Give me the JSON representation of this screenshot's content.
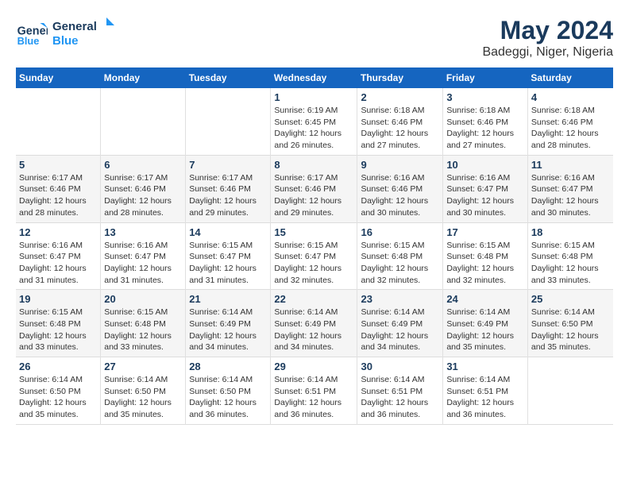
{
  "header": {
    "logo_line1": "General",
    "logo_line2": "Blue",
    "month": "May 2024",
    "location": "Badeggi, Niger, Nigeria"
  },
  "days_of_week": [
    "Sunday",
    "Monday",
    "Tuesday",
    "Wednesday",
    "Thursday",
    "Friday",
    "Saturday"
  ],
  "weeks": [
    [
      {
        "day": "",
        "info": ""
      },
      {
        "day": "",
        "info": ""
      },
      {
        "day": "",
        "info": ""
      },
      {
        "day": "1",
        "info": "Sunrise: 6:19 AM\nSunset: 6:45 PM\nDaylight: 12 hours\nand 26 minutes."
      },
      {
        "day": "2",
        "info": "Sunrise: 6:18 AM\nSunset: 6:46 PM\nDaylight: 12 hours\nand 27 minutes."
      },
      {
        "day": "3",
        "info": "Sunrise: 6:18 AM\nSunset: 6:46 PM\nDaylight: 12 hours\nand 27 minutes."
      },
      {
        "day": "4",
        "info": "Sunrise: 6:18 AM\nSunset: 6:46 PM\nDaylight: 12 hours\nand 28 minutes."
      }
    ],
    [
      {
        "day": "5",
        "info": "Sunrise: 6:17 AM\nSunset: 6:46 PM\nDaylight: 12 hours\nand 28 minutes."
      },
      {
        "day": "6",
        "info": "Sunrise: 6:17 AM\nSunset: 6:46 PM\nDaylight: 12 hours\nand 28 minutes."
      },
      {
        "day": "7",
        "info": "Sunrise: 6:17 AM\nSunset: 6:46 PM\nDaylight: 12 hours\nand 29 minutes."
      },
      {
        "day": "8",
        "info": "Sunrise: 6:17 AM\nSunset: 6:46 PM\nDaylight: 12 hours\nand 29 minutes."
      },
      {
        "day": "9",
        "info": "Sunrise: 6:16 AM\nSunset: 6:46 PM\nDaylight: 12 hours\nand 30 minutes."
      },
      {
        "day": "10",
        "info": "Sunrise: 6:16 AM\nSunset: 6:47 PM\nDaylight: 12 hours\nand 30 minutes."
      },
      {
        "day": "11",
        "info": "Sunrise: 6:16 AM\nSunset: 6:47 PM\nDaylight: 12 hours\nand 30 minutes."
      }
    ],
    [
      {
        "day": "12",
        "info": "Sunrise: 6:16 AM\nSunset: 6:47 PM\nDaylight: 12 hours\nand 31 minutes."
      },
      {
        "day": "13",
        "info": "Sunrise: 6:16 AM\nSunset: 6:47 PM\nDaylight: 12 hours\nand 31 minutes."
      },
      {
        "day": "14",
        "info": "Sunrise: 6:15 AM\nSunset: 6:47 PM\nDaylight: 12 hours\nand 31 minutes."
      },
      {
        "day": "15",
        "info": "Sunrise: 6:15 AM\nSunset: 6:47 PM\nDaylight: 12 hours\nand 32 minutes."
      },
      {
        "day": "16",
        "info": "Sunrise: 6:15 AM\nSunset: 6:48 PM\nDaylight: 12 hours\nand 32 minutes."
      },
      {
        "day": "17",
        "info": "Sunrise: 6:15 AM\nSunset: 6:48 PM\nDaylight: 12 hours\nand 32 minutes."
      },
      {
        "day": "18",
        "info": "Sunrise: 6:15 AM\nSunset: 6:48 PM\nDaylight: 12 hours\nand 33 minutes."
      }
    ],
    [
      {
        "day": "19",
        "info": "Sunrise: 6:15 AM\nSunset: 6:48 PM\nDaylight: 12 hours\nand 33 minutes."
      },
      {
        "day": "20",
        "info": "Sunrise: 6:15 AM\nSunset: 6:48 PM\nDaylight: 12 hours\nand 33 minutes."
      },
      {
        "day": "21",
        "info": "Sunrise: 6:14 AM\nSunset: 6:49 PM\nDaylight: 12 hours\nand 34 minutes."
      },
      {
        "day": "22",
        "info": "Sunrise: 6:14 AM\nSunset: 6:49 PM\nDaylight: 12 hours\nand 34 minutes."
      },
      {
        "day": "23",
        "info": "Sunrise: 6:14 AM\nSunset: 6:49 PM\nDaylight: 12 hours\nand 34 minutes."
      },
      {
        "day": "24",
        "info": "Sunrise: 6:14 AM\nSunset: 6:49 PM\nDaylight: 12 hours\nand 35 minutes."
      },
      {
        "day": "25",
        "info": "Sunrise: 6:14 AM\nSunset: 6:50 PM\nDaylight: 12 hours\nand 35 minutes."
      }
    ],
    [
      {
        "day": "26",
        "info": "Sunrise: 6:14 AM\nSunset: 6:50 PM\nDaylight: 12 hours\nand 35 minutes."
      },
      {
        "day": "27",
        "info": "Sunrise: 6:14 AM\nSunset: 6:50 PM\nDaylight: 12 hours\nand 35 minutes."
      },
      {
        "day": "28",
        "info": "Sunrise: 6:14 AM\nSunset: 6:50 PM\nDaylight: 12 hours\nand 36 minutes."
      },
      {
        "day": "29",
        "info": "Sunrise: 6:14 AM\nSunset: 6:51 PM\nDaylight: 12 hours\nand 36 minutes."
      },
      {
        "day": "30",
        "info": "Sunrise: 6:14 AM\nSunset: 6:51 PM\nDaylight: 12 hours\nand 36 minutes."
      },
      {
        "day": "31",
        "info": "Sunrise: 6:14 AM\nSunset: 6:51 PM\nDaylight: 12 hours\nand 36 minutes."
      },
      {
        "day": "",
        "info": ""
      }
    ]
  ]
}
